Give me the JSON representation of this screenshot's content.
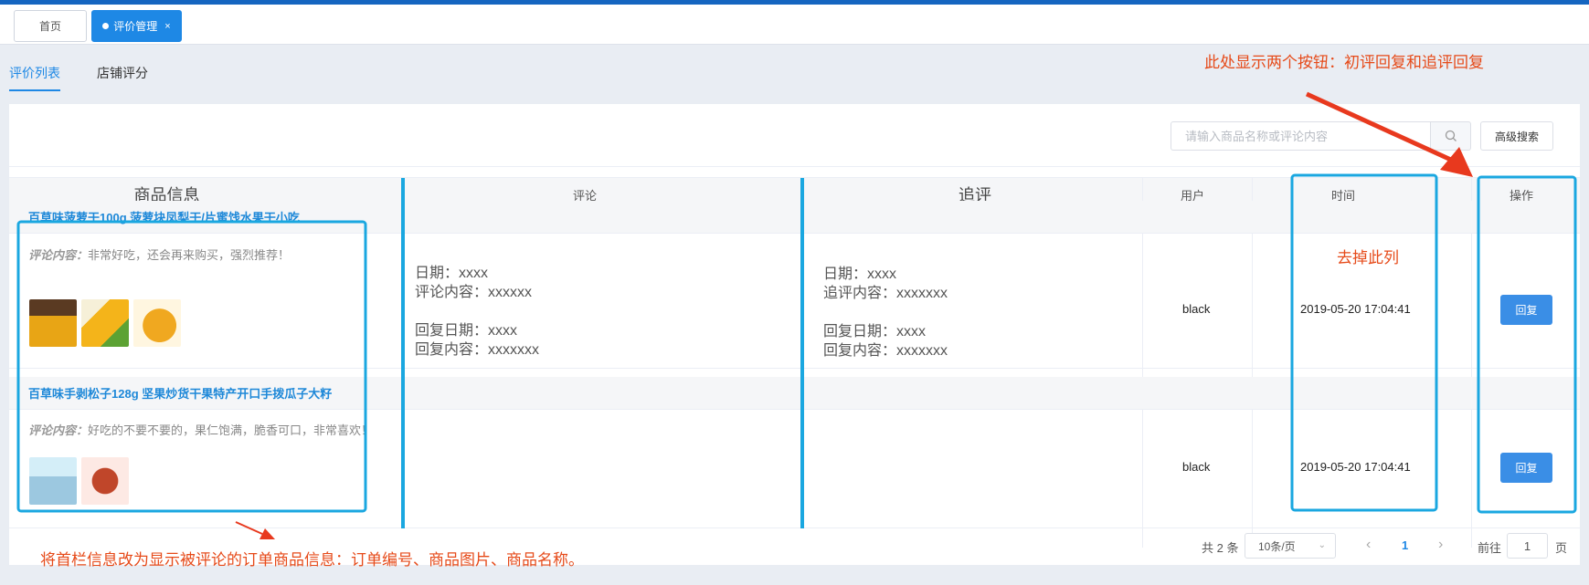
{
  "nav_tabs": {
    "home": "首页",
    "active": "评价管理",
    "close_glyph": "×"
  },
  "sub_tabs": {
    "list": "评价列表",
    "shop": "店铺评分"
  },
  "search": {
    "placeholder": "请输入商品名称或评论内容",
    "advanced": "高级搜索"
  },
  "columns": {
    "product": "商品信息",
    "comment": "评论",
    "followup": "追评",
    "user": "用户",
    "time": "时间",
    "action": "操作"
  },
  "rows": [
    {
      "title": "百草味菠萝干100g 菠萝块凤梨干/片蜜饯水果干小吃",
      "comment_label": "评论内容：",
      "comment": "非常好吃，还会再来购买，强烈推荐！",
      "review": "日期：xxxx\n评论内容：xxxxxx\n\n回复日期：xxxx\n回复内容：xxxxxxx",
      "followup": "日期：xxxx\n追评内容：xxxxxxx\n\n回复日期：xxxx\n回复内容：xxxxxxx",
      "user": "black",
      "time": "2019-05-20 17:04:41",
      "action": "回复"
    },
    {
      "title": "百草味手剥松子128g 坚果炒货干果特产开口手拨瓜子大籽",
      "comment_label": "评论内容：",
      "comment": "好吃的不要不要的，果仁饱满，脆香可口，非常喜欢！",
      "review": "",
      "followup": "",
      "user": "black",
      "time": "2019-05-20 17:04:41",
      "action": "回复"
    }
  ],
  "pagination": {
    "total": "共 2 条",
    "page_size": "10条/页",
    "current": "1",
    "goto_label": "前往",
    "goto_value": "1",
    "page_unit": "页"
  },
  "annotations": {
    "top_right": "此处显示两个按钮：初评回复和追评回复",
    "remove_column": "去掉此列",
    "bottom": "将首栏信息改为显示被评论的订单商品信息：订单编号、商品图片、商品名称。"
  },
  "colors": {
    "accent": "#1e88e5",
    "annotation_box": "#1aa7e0",
    "annotation_text": "#e64a19"
  }
}
